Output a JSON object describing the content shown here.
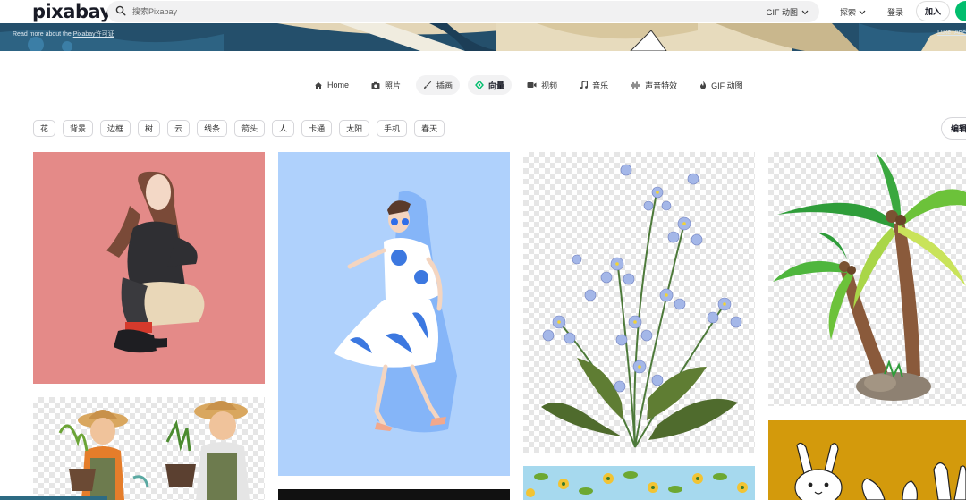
{
  "header": {
    "logo": "pixabay",
    "search_placeholder": "搜索Pixabay",
    "filter_label": "GIF 动图",
    "explore_label": "探索",
    "login_label": "登录",
    "join_label": "加入"
  },
  "banner": {
    "text_prefix": "Read more about the ",
    "text_link": "Pixabay许可证",
    "credit": "Luke_Arte"
  },
  "categories": [
    {
      "label": "Home",
      "icon": "home-icon"
    },
    {
      "label": "照片",
      "icon": "camera-icon"
    },
    {
      "label": "插画",
      "icon": "brush-icon"
    },
    {
      "label": "向量",
      "icon": "vector-icon"
    },
    {
      "label": "视频",
      "icon": "video-icon"
    },
    {
      "label": "音乐",
      "icon": "music-icon"
    },
    {
      "label": "声音特效",
      "icon": "waveform-icon"
    },
    {
      "label": "GIF 动图",
      "icon": "fire-icon"
    }
  ],
  "active_category": "向量",
  "tags": [
    "花",
    "背景",
    "边框",
    "树",
    "云",
    "线条",
    "箭头",
    "人",
    "卡通",
    "太阳",
    "手机",
    "春天"
  ],
  "edit_label": "编辑",
  "colors": {
    "brand_green": "#02be6e",
    "banner_blue": "#234e6a",
    "pink_card": "#e48a88",
    "blue_card": "#afd1fc",
    "mustard_card": "#d39a0c"
  }
}
